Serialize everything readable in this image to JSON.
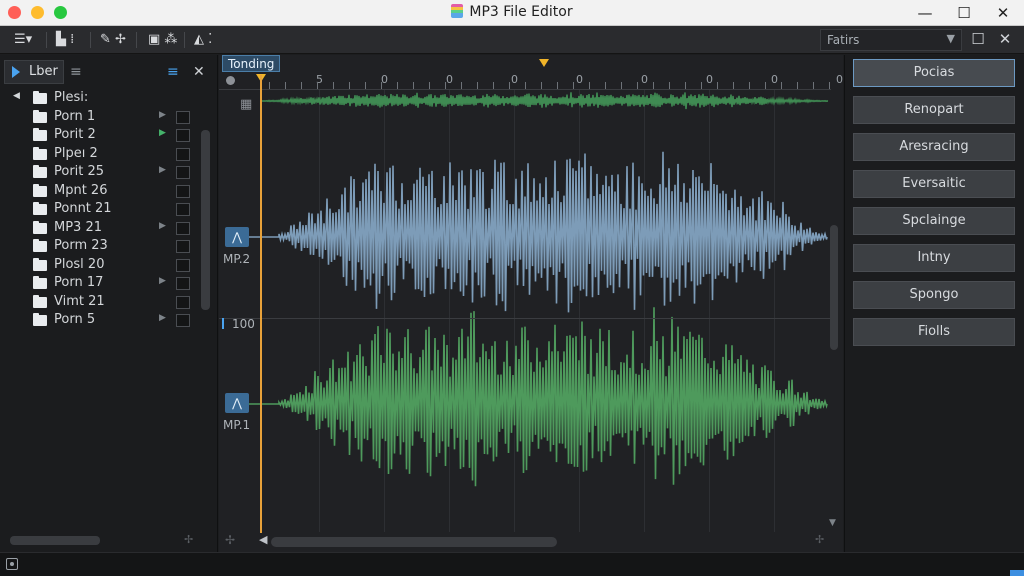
{
  "window": {
    "title": "MP3 File Editor",
    "min_icon": "minimize-icon",
    "max_icon": "maximize-icon",
    "close_icon": "close-icon"
  },
  "toolbar": {
    "dropdown_value": "Fatirs"
  },
  "sidebar": {
    "tab_label": "Lber",
    "root": "Plesi:",
    "items": [
      {
        "label": "Porn 1",
        "arrow": true,
        "green": false
      },
      {
        "label": "Porit 2",
        "arrow": true,
        "green": true
      },
      {
        "label": "Plpeı 2",
        "arrow": false,
        "green": false
      },
      {
        "label": "Porit 25",
        "arrow": true,
        "green": false
      },
      {
        "label": "Mpnt 26",
        "arrow": false,
        "green": false
      },
      {
        "label": "Ponnt 21",
        "arrow": false,
        "green": false
      },
      {
        "label": "MP3 21",
        "arrow": true,
        "green": false
      },
      {
        "label": "Porm 23",
        "arrow": false,
        "green": false
      },
      {
        "label": "Plosl 20",
        "arrow": false,
        "green": false
      },
      {
        "label": "Porn 17",
        "arrow": true,
        "green": false
      },
      {
        "label": "Vimt 21",
        "arrow": false,
        "green": false
      },
      {
        "label": "Porn 5",
        "arrow": true,
        "green": false
      }
    ]
  },
  "editor": {
    "track_tag": "Tonding",
    "ruler_labels": [
      "5",
      "0",
      "0",
      "0",
      "0",
      "0",
      "0",
      "0",
      "0",
      "0"
    ],
    "db_label": "100",
    "tracks": [
      {
        "name": "MP.2",
        "color": "#7d9cb8"
      },
      {
        "name": "MP.1",
        "color": "#4e9a5c"
      }
    ],
    "overview_color": "#3f8a52"
  },
  "right_panel": {
    "buttons": [
      "Pocias",
      "Renopart",
      "Aresracing",
      "Eversaitic",
      "Spclainge",
      "Intny",
      "Spongo",
      "Fiolls"
    ]
  }
}
